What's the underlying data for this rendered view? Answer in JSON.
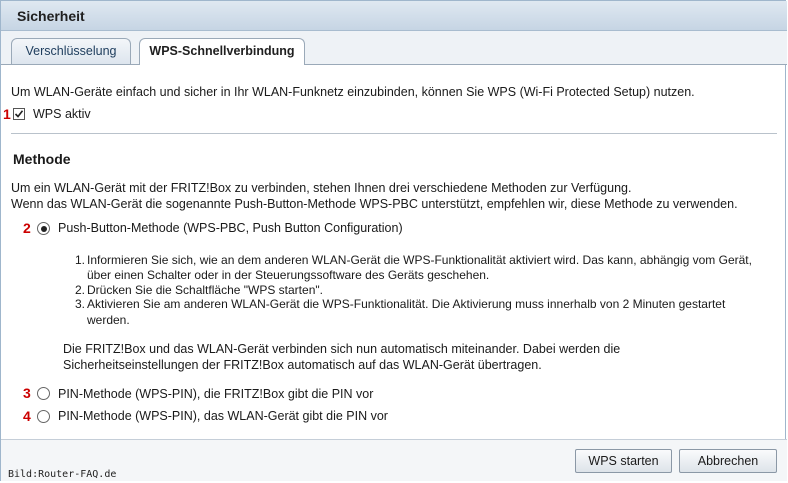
{
  "window": {
    "title": "Sicherheit"
  },
  "tabs": [
    {
      "label": "Verschlüsselung",
      "active": false
    },
    {
      "label": "WPS-Schnellverbindung",
      "active": true
    }
  ],
  "intro": "Um WLAN-Geräte einfach und sicher in Ihr WLAN-Funknetz einzubinden, können Sie WPS (Wi-Fi Protected Setup) nutzen.",
  "wps_active": {
    "label": "WPS aktiv",
    "checked": true,
    "marker": "1"
  },
  "method": {
    "heading": "Methode",
    "desc_line1": "Um ein WLAN-Gerät mit der FRITZ!Box zu verbinden, stehen Ihnen drei verschiedene Methoden zur Verfügung.",
    "desc_line2": "Wenn das WLAN-Gerät die sogenannte Push-Button-Methode WPS-PBC unterstützt, empfehlen wir, diese Methode zu verwenden.",
    "options": [
      {
        "marker": "2",
        "label": "Push-Button-Methode (WPS-PBC, Push Button Configuration)",
        "selected": true
      },
      {
        "marker": "3",
        "label": "PIN-Methode (WPS-PIN), die FRITZ!Box gibt die PIN vor",
        "selected": false
      },
      {
        "marker": "4",
        "label": "PIN-Methode (WPS-PIN), das WLAN-Gerät gibt die PIN vor",
        "selected": false
      }
    ],
    "steps": [
      {
        "num": "1.",
        "line1": "Informieren Sie sich, wie an dem anderen WLAN-Gerät die WPS-Funktionalität aktiviert wird. Das kann, abhängig vom Gerät,",
        "line2": "über einen Schalter oder in der Steuerungssoftware des Geräts geschehen."
      },
      {
        "num": "2.",
        "line1": "Drücken Sie die Schaltfläche \"WPS starten\".",
        "line2": ""
      },
      {
        "num": "3.",
        "line1": "Aktivieren Sie am anderen WLAN-Gerät die WPS-Funktionalität. Die Aktivierung muss innerhalb von 2 Minuten gestartet",
        "line2": "werden."
      }
    ],
    "note_line1": "Die FRITZ!Box und das WLAN-Gerät verbinden sich nun automatisch miteinander. Dabei werden die",
    "note_line2": "Sicherheitseinstellungen der FRITZ!Box automatisch auf das WLAN-Gerät übertragen."
  },
  "buttons": {
    "start": "WPS starten",
    "cancel": "Abbrechen"
  },
  "credit": "Bild:Router-FAQ.de"
}
